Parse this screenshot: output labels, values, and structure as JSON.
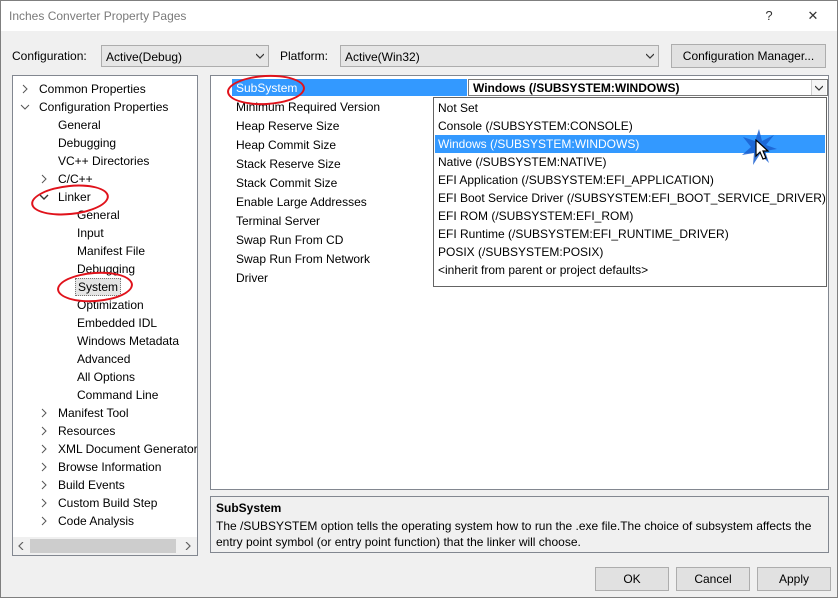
{
  "window": {
    "title": "Inches Converter Property Pages",
    "help": "?",
    "close": "✕"
  },
  "config": {
    "label": "Configuration:",
    "value": "Active(Debug)"
  },
  "platform": {
    "label": "Platform:",
    "value": "Active(Win32)"
  },
  "config_manager": "Configuration Manager...",
  "tree": [
    {
      "label": "Common Properties",
      "state": "collapsed"
    },
    {
      "label": "Configuration Properties",
      "state": "expanded"
    },
    {
      "label": "General"
    },
    {
      "label": "Debugging"
    },
    {
      "label": "VC++ Directories"
    },
    {
      "label": "C/C++",
      "state": "collapsed"
    },
    {
      "label": "Linker",
      "state": "expanded"
    },
    {
      "label": "General"
    },
    {
      "label": "Input"
    },
    {
      "label": "Manifest File"
    },
    {
      "label": "Debugging"
    },
    {
      "label": "System",
      "selected": true
    },
    {
      "label": "Optimization"
    },
    {
      "label": "Embedded IDL"
    },
    {
      "label": "Windows Metadata"
    },
    {
      "label": "Advanced"
    },
    {
      "label": "All Options"
    },
    {
      "label": "Command Line"
    },
    {
      "label": "Manifest Tool",
      "state": "collapsed"
    },
    {
      "label": "Resources",
      "state": "collapsed"
    },
    {
      "label": "XML Document Generator",
      "state": "collapsed"
    },
    {
      "label": "Browse Information",
      "state": "collapsed"
    },
    {
      "label": "Build Events",
      "state": "collapsed"
    },
    {
      "label": "Custom Build Step",
      "state": "collapsed"
    },
    {
      "label": "Code Analysis",
      "state": "collapsed"
    }
  ],
  "properties": [
    {
      "name": "SubSystem",
      "value": "Windows (/SUBSYSTEM:WINDOWS)"
    },
    {
      "name": "Minimum Required Version"
    },
    {
      "name": "Heap Reserve Size"
    },
    {
      "name": "Heap Commit Size"
    },
    {
      "name": "Stack Reserve Size"
    },
    {
      "name": "Stack Commit Size"
    },
    {
      "name": "Enable Large Addresses"
    },
    {
      "name": "Terminal Server"
    },
    {
      "name": "Swap Run From CD"
    },
    {
      "name": "Swap Run From Network"
    },
    {
      "name": "Driver"
    }
  ],
  "dropdown": [
    "Not Set",
    "Console (/SUBSYSTEM:CONSOLE)",
    "Windows (/SUBSYSTEM:WINDOWS)",
    "Native (/SUBSYSTEM:NATIVE)",
    "EFI Application (/SUBSYSTEM:EFI_APPLICATION)",
    "EFI Boot Service Driver (/SUBSYSTEM:EFI_BOOT_SERVICE_DRIVER)",
    "EFI ROM (/SUBSYSTEM:EFI_ROM)",
    "EFI Runtime (/SUBSYSTEM:EFI_RUNTIME_DRIVER)",
    "POSIX (/SUBSYSTEM:POSIX)",
    "<inherit from parent or project defaults>"
  ],
  "dropdown_highlighted": "Windows (/SUBSYSTEM:WINDOWS)",
  "description": {
    "title": "SubSystem",
    "text": "The /SUBSYSTEM option tells the operating system how to run the .exe file.The choice of subsystem affects the entry point symbol (or entry point function) that the linker will choose."
  },
  "buttons": {
    "ok": "OK",
    "cancel": "Cancel",
    "apply": "Apply"
  },
  "colors": {
    "selection": "#3399ff",
    "annotation": "#e0121b"
  }
}
